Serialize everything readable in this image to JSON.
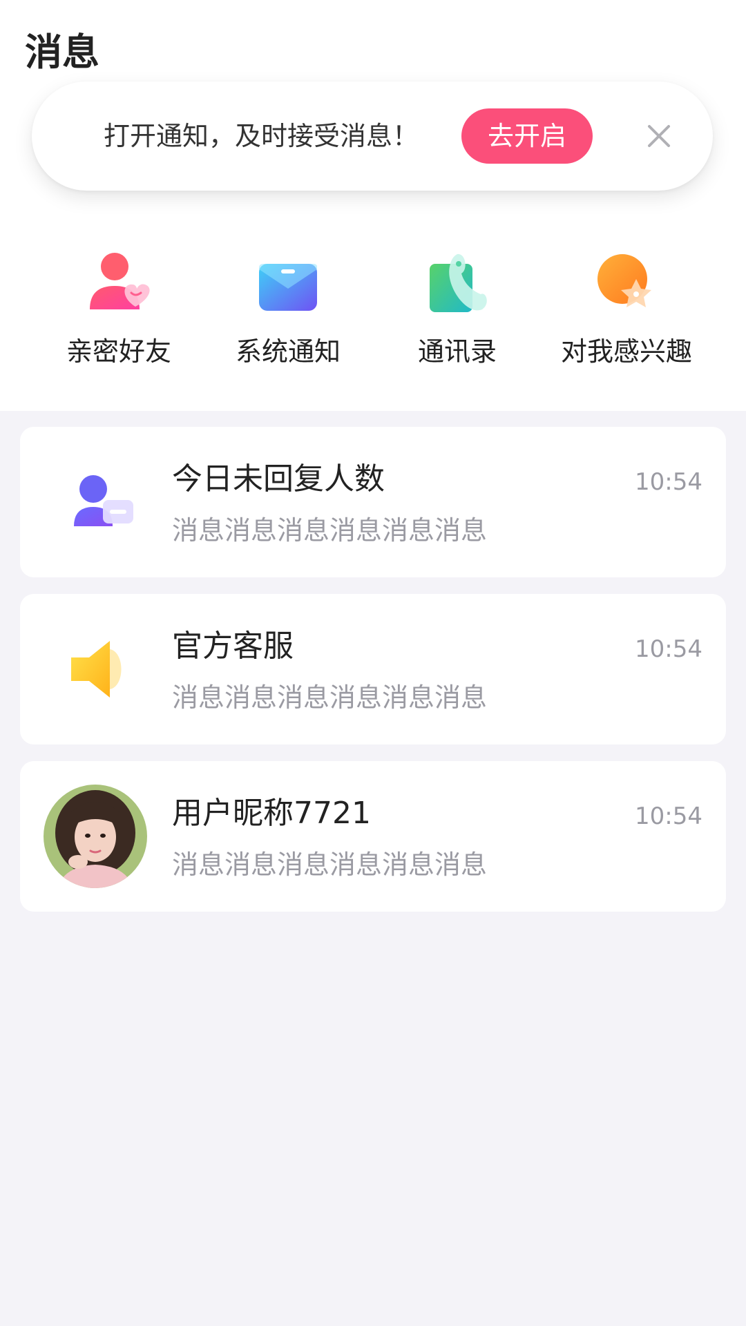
{
  "header": {
    "title": "消息"
  },
  "notify_bar": {
    "text": "打开通知，及时接受消息！",
    "button_label": "去开启",
    "close_icon": "close-icon"
  },
  "shortcuts": [
    {
      "label": "亲密好友",
      "icon": "intimate-friends-icon"
    },
    {
      "label": "系统通知",
      "icon": "envelope-icon"
    },
    {
      "label": "通讯录",
      "icon": "contacts-phone-icon"
    },
    {
      "label": "对我感兴趣",
      "icon": "star-interest-icon"
    }
  ],
  "messages": [
    {
      "name": "今日未回复人数",
      "preview": "消息消息消息消息消息消息",
      "time": "10:54",
      "avatar": "user-chat-icon"
    },
    {
      "name": "官方客服",
      "preview": "消息消息消息消息消息消息",
      "time": "10:54",
      "avatar": "speaker-icon"
    },
    {
      "name": "用户昵称7721",
      "preview": "消息消息消息消息消息消息",
      "time": "10:54",
      "avatar": "user-avatar"
    }
  ],
  "colors": {
    "accent": "#fb4f7a",
    "background": "#f4f3f8",
    "card": "#ffffff",
    "muted_text": "#9a9aa2"
  }
}
